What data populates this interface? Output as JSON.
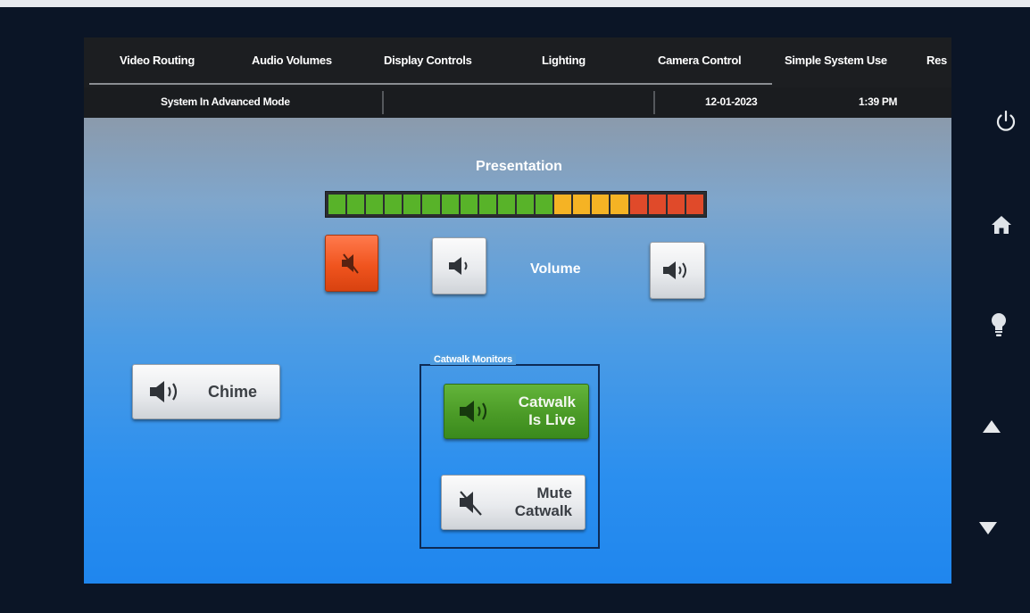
{
  "tabs": [
    "Video Routing",
    "Audio Volumes",
    "Display Controls",
    "Lighting",
    "Camera Control",
    "Simple System Use",
    "Res"
  ],
  "status": {
    "mode": "System In Advanced Mode",
    "date": "12-01-2023",
    "time": "1:39 PM"
  },
  "presentation": {
    "title": "Presentation",
    "meter_level_fraction": 1.0,
    "meter_segments": 20,
    "volume_label": "Volume",
    "mute_active": true
  },
  "chime": {
    "label": "Chime"
  },
  "catwalk": {
    "group_title": "Catwalk Monitors",
    "live_line1": "Catwalk",
    "live_line2": "Is Live",
    "mute_line1": "Mute",
    "mute_line2": "Catwalk"
  },
  "side_icons": [
    "power-icon",
    "home-icon",
    "lightbulb-icon",
    "up-arrow-icon",
    "down-arrow-icon"
  ],
  "colors": {
    "meter_green": "#58b329",
    "meter_yellow": "#f5b324",
    "meter_red": "#e04a2a",
    "mute_active": "#f0541e",
    "live_green": "#4b9b27"
  }
}
